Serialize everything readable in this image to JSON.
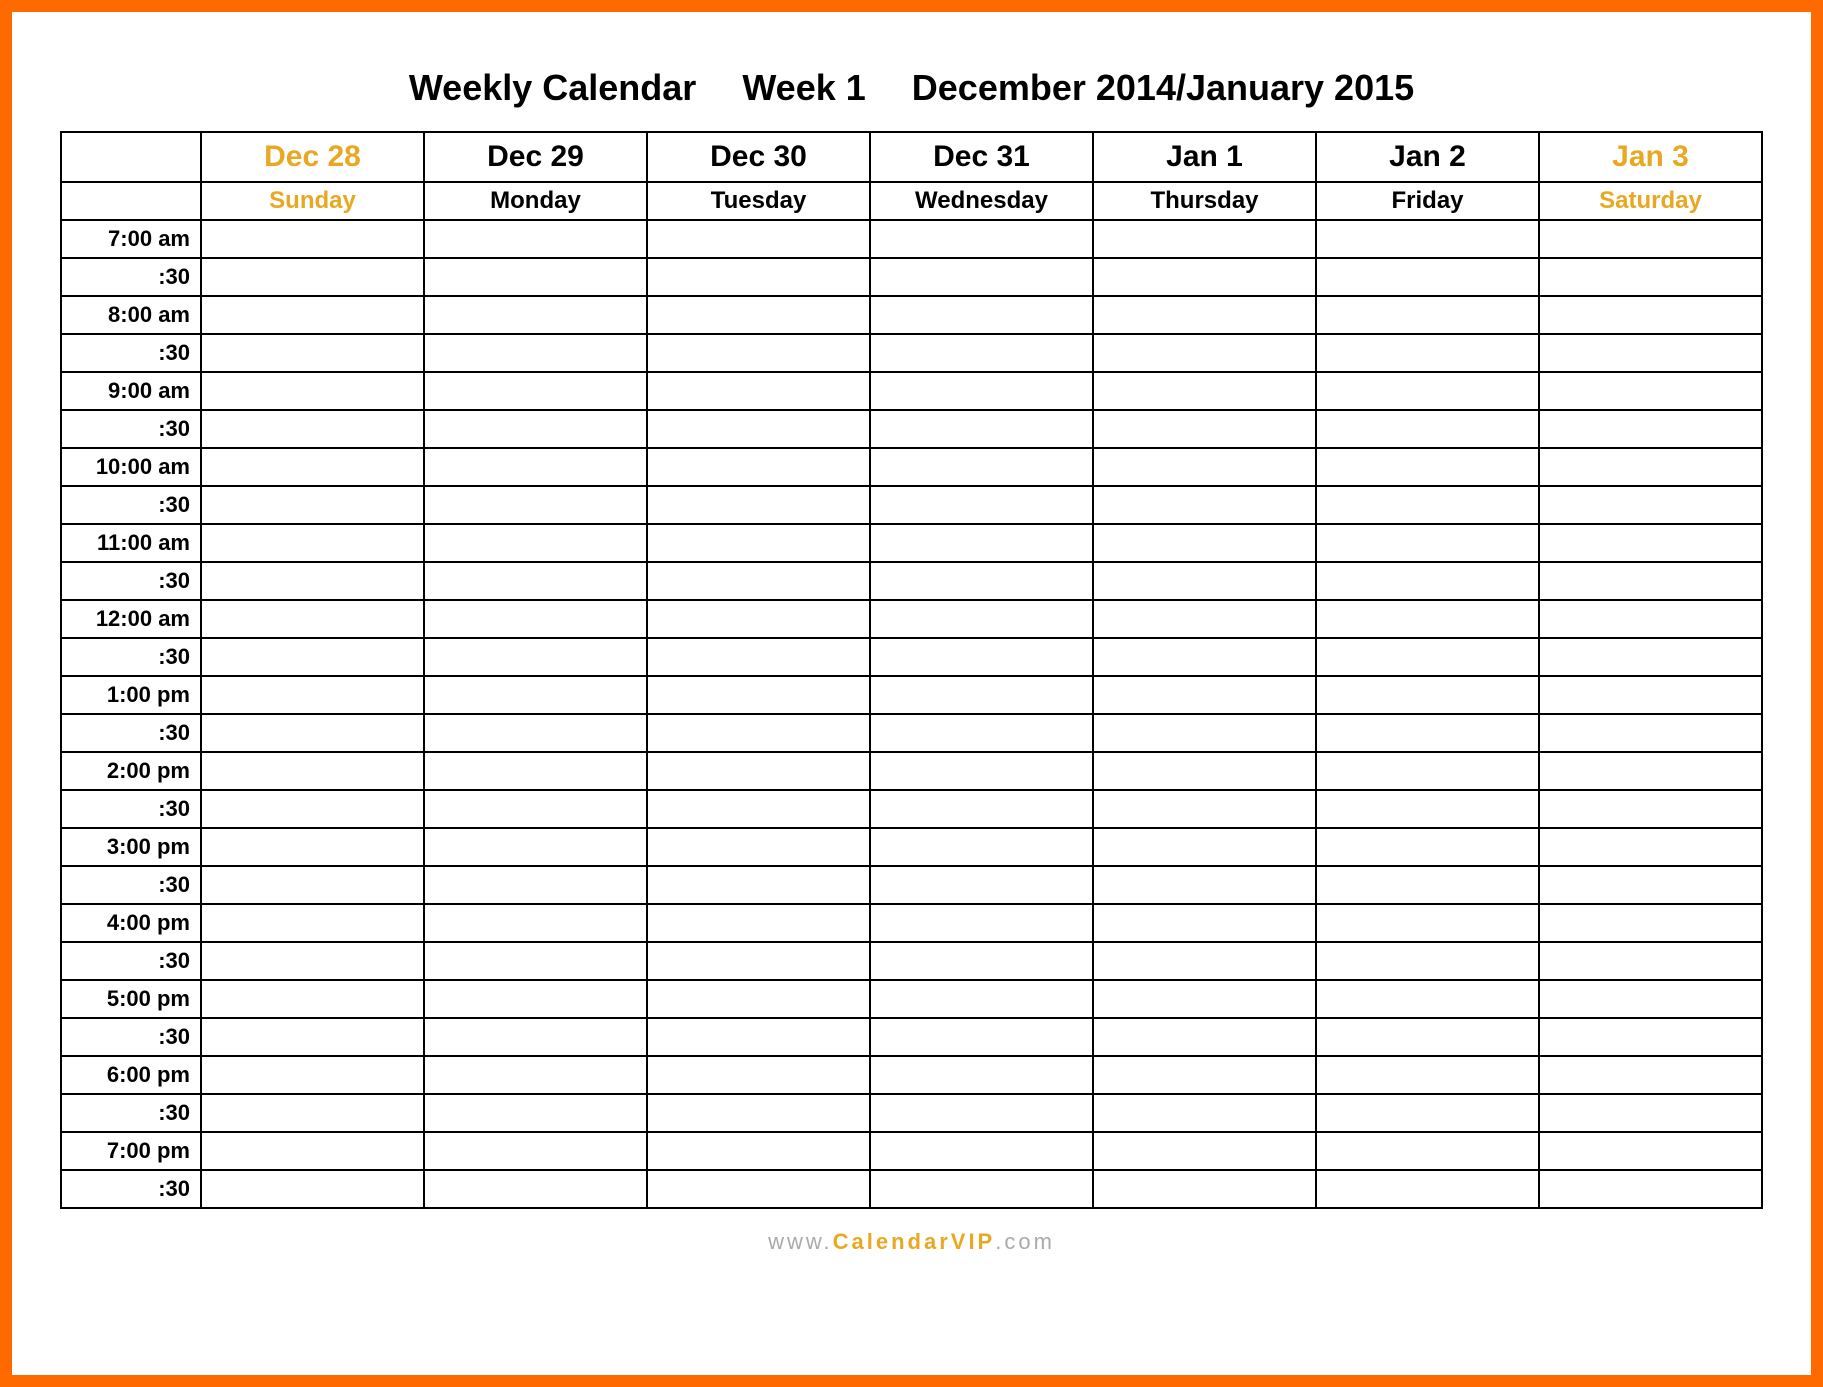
{
  "title": {
    "part1": "Weekly Calendar",
    "part2": "Week 1",
    "part3": "December 2014/January 2015"
  },
  "columns": [
    {
      "date": "Dec 28",
      "day": "Sunday",
      "weekend": true
    },
    {
      "date": "Dec 29",
      "day": "Monday",
      "weekend": false
    },
    {
      "date": "Dec 30",
      "day": "Tuesday",
      "weekend": false
    },
    {
      "date": "Dec 31",
      "day": "Wednesday",
      "weekend": false
    },
    {
      "date": "Jan 1",
      "day": "Thursday",
      "weekend": false
    },
    {
      "date": "Jan 2",
      "day": "Friday",
      "weekend": false
    },
    {
      "date": "Jan 3",
      "day": "Saturday",
      "weekend": true
    }
  ],
  "timeRows": [
    "7:00 am",
    ":30",
    "8:00 am",
    ":30",
    "9:00 am",
    ":30",
    "10:00 am",
    ":30",
    "11:00 am",
    ":30",
    "12:00 am",
    ":30",
    "1:00 pm",
    ":30",
    "2:00 pm",
    ":30",
    "3:00 pm",
    ":30",
    "4:00 pm",
    ":30",
    "5:00 pm",
    ":30",
    "6:00 pm",
    ":30",
    "7:00 pm",
    ":30"
  ],
  "footer": {
    "prefix": "www.",
    "brand": "CalendarVIP",
    "suffix": ".com"
  }
}
